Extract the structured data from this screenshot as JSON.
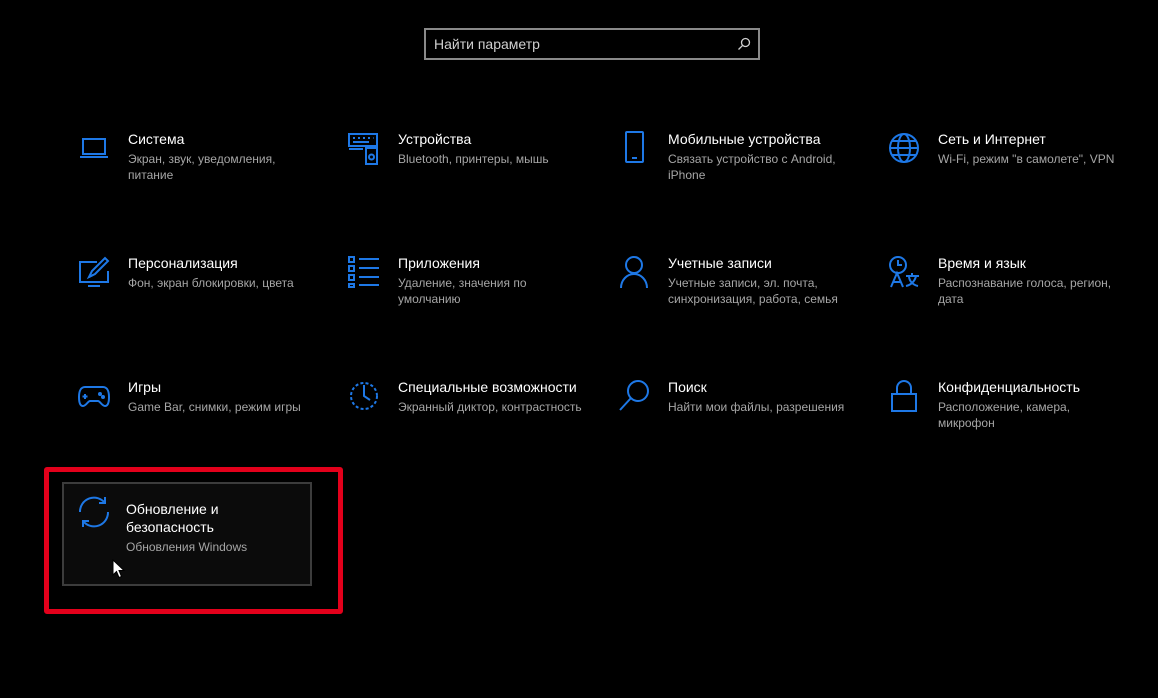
{
  "search": {
    "placeholder": "Найти параметр"
  },
  "colors": {
    "accent": "#1e78e6",
    "highlight_border": "#e3001b",
    "desc": "#a6a6a6"
  },
  "tiles": [
    {
      "title": "Система",
      "desc": "Экран, звук, уведомления, питание",
      "icon": "laptop-icon"
    },
    {
      "title": "Устройства",
      "desc": "Bluetooth, принтеры, мышь",
      "icon": "keyboard-speaker-icon"
    },
    {
      "title": "Мобильные устройства",
      "desc": "Связать устройство с Android, iPhone",
      "icon": "phone-icon"
    },
    {
      "title": "Сеть и Интернет",
      "desc": "Wi-Fi, режим \"в самолете\", VPN",
      "icon": "globe-icon"
    },
    {
      "title": "Персонализация",
      "desc": "Фон, экран блокировки, цвета",
      "icon": "paint-display-icon"
    },
    {
      "title": "Приложения",
      "desc": "Удаление, значения по умолчанию",
      "icon": "app-list-icon"
    },
    {
      "title": "Учетные записи",
      "desc": "Учетные записи, эл. почта, синхронизация, работа, семья",
      "icon": "person-icon"
    },
    {
      "title": "Время и язык",
      "desc": "Распознавание голоса, регион, дата",
      "icon": "time-language-icon"
    },
    {
      "title": "Игры",
      "desc": "Game Bar, снимки, режим игры",
      "icon": "gamepad-icon"
    },
    {
      "title": "Специальные возможности",
      "desc": "Экранный диктор, контрастность",
      "icon": "accessibility-timer-icon"
    },
    {
      "title": "Поиск",
      "desc": "Найти мои файлы, разрешения",
      "icon": "magnifier-icon"
    },
    {
      "title": "Конфиденциальность",
      "desc": "Расположение, камера, микрофон",
      "icon": "lock-icon"
    },
    {
      "title": "Обновление и безопасность",
      "desc": "Обновления Windows",
      "icon": "sync-icon"
    }
  ]
}
